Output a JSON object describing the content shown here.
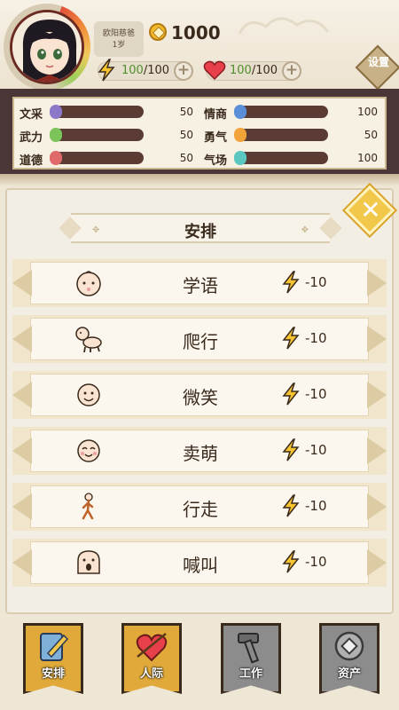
{
  "player": {
    "name": "欧阳慈爸",
    "age": "1岁",
    "coins": "1000",
    "energy_current": "100",
    "energy_max": "/100",
    "health_current": "100",
    "health_max": "/100"
  },
  "settings_label": "设置",
  "stats": [
    {
      "label": "文采",
      "value": "50",
      "color": "#8c78c9"
    },
    {
      "label": "武力",
      "value": "50",
      "color": "#7cc35a"
    },
    {
      "label": "道德",
      "value": "50",
      "color": "#e06a6a"
    },
    {
      "label": "情商",
      "value": "100",
      "color": "#5a8fd8"
    },
    {
      "label": "勇气",
      "value": "50",
      "color": "#f2a43a"
    },
    {
      "label": "气场",
      "value": "100",
      "color": "#5ac7c0"
    }
  ],
  "panel": {
    "title": "安排",
    "close_glyph": "✕"
  },
  "actions": [
    {
      "label": "学语",
      "cost": "-10",
      "icon": "baby-face-icon"
    },
    {
      "label": "爬行",
      "cost": "-10",
      "icon": "crawling-baby-icon"
    },
    {
      "label": "微笑",
      "cost": "-10",
      "icon": "smile-face-icon"
    },
    {
      "label": "卖萌",
      "cost": "-10",
      "icon": "cute-face-icon"
    },
    {
      "label": "行走",
      "cost": "-10",
      "icon": "walking-figure-icon"
    },
    {
      "label": "喊叫",
      "cost": "-10",
      "icon": "shouting-face-icon"
    }
  ],
  "nav": [
    {
      "label": "安排",
      "icon": "notebook-pencil-icon",
      "color": "#e0a93a"
    },
    {
      "label": "人际",
      "icon": "heart-arrow-icon",
      "color": "#e0a93a"
    },
    {
      "label": "工作",
      "icon": "hammer-icon",
      "color": "#8c8c8c"
    },
    {
      "label": "资产",
      "icon": "coin-icon",
      "color": "#8c8c8c"
    }
  ]
}
